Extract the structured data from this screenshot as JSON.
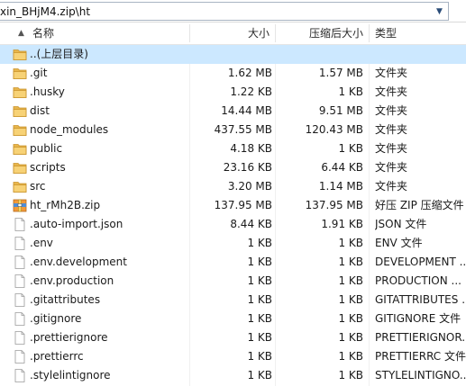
{
  "address": {
    "path": "xin_BHjM4.zip\\ht"
  },
  "columns": {
    "name": "名称",
    "size": "大小",
    "compressed": "压缩后大小",
    "type": "类型"
  },
  "rows": [
    {
      "name": "..(上层目录)",
      "size": "",
      "compressed": "",
      "type": "",
      "icon": "folder-icon",
      "selected": true
    },
    {
      "name": ".git",
      "size": "1.62 MB",
      "compressed": "1.57 MB",
      "type": "文件夹",
      "icon": "folder-icon"
    },
    {
      "name": ".husky",
      "size": "1.22 KB",
      "compressed": "1 KB",
      "type": "文件夹",
      "icon": "folder-icon"
    },
    {
      "name": "dist",
      "size": "14.44 MB",
      "compressed": "9.51 MB",
      "type": "文件夹",
      "icon": "folder-icon"
    },
    {
      "name": "node_modules",
      "size": "437.55 MB",
      "compressed": "120.43 MB",
      "type": "文件夹",
      "icon": "folder-icon"
    },
    {
      "name": "public",
      "size": "4.18 KB",
      "compressed": "1 KB",
      "type": "文件夹",
      "icon": "folder-icon"
    },
    {
      "name": "scripts",
      "size": "23.16 KB",
      "compressed": "6.44 KB",
      "type": "文件夹",
      "icon": "folder-icon"
    },
    {
      "name": "src",
      "size": "3.20 MB",
      "compressed": "1.14 MB",
      "type": "文件夹",
      "icon": "folder-icon"
    },
    {
      "name": "ht_rMh2B.zip",
      "size": "137.95 MB",
      "compressed": "137.95 MB",
      "type": "好压 ZIP 压缩文件",
      "icon": "zip-archive-icon"
    },
    {
      "name": ".auto-import.json",
      "size": "8.44 KB",
      "compressed": "1.91 KB",
      "type": "JSON 文件",
      "icon": "file-icon"
    },
    {
      "name": ".env",
      "size": "1 KB",
      "compressed": "1 KB",
      "type": "ENV 文件",
      "icon": "file-icon"
    },
    {
      "name": ".env.development",
      "size": "1 KB",
      "compressed": "1 KB",
      "type": "DEVELOPMENT ...",
      "icon": "file-icon"
    },
    {
      "name": ".env.production",
      "size": "1 KB",
      "compressed": "1 KB",
      "type": "PRODUCTION ...",
      "icon": "file-icon"
    },
    {
      "name": ".gitattributes",
      "size": "1 KB",
      "compressed": "1 KB",
      "type": "GITATTRIBUTES ...",
      "icon": "file-icon"
    },
    {
      "name": ".gitignore",
      "size": "1 KB",
      "compressed": "1 KB",
      "type": "GITIGNORE 文件",
      "icon": "file-icon"
    },
    {
      "name": ".prettierignore",
      "size": "1 KB",
      "compressed": "1 KB",
      "type": "PRETTIERIGNOR...",
      "icon": "file-icon"
    },
    {
      "name": ".prettierrc",
      "size": "1 KB",
      "compressed": "1 KB",
      "type": "PRETTIERRC 文件",
      "icon": "file-icon"
    },
    {
      "name": ".stylelintignore",
      "size": "1 KB",
      "compressed": "1 KB",
      "type": "STYLELINTIGNO...",
      "icon": "file-icon"
    }
  ]
}
